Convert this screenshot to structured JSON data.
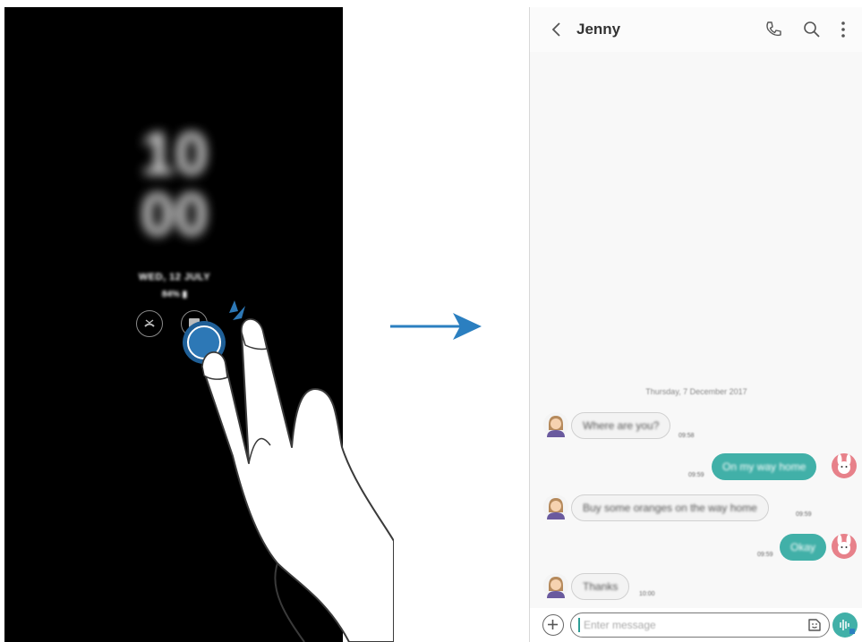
{
  "aod": {
    "clock_hour": "10",
    "clock_minute": "00",
    "date": "WED, 12 JULY",
    "battery": "84%"
  },
  "conversation": {
    "contact_name": "Jenny",
    "date_separator": "Thursday, 7 December 2017",
    "messages": [
      {
        "direction": "in",
        "text": "Where are you?",
        "time": "09:58"
      },
      {
        "direction": "out",
        "text": "On my way home",
        "time": "09:59"
      },
      {
        "direction": "in",
        "text": "Buy some oranges on the way home",
        "time": "09:59"
      },
      {
        "direction": "out",
        "text": "Okay",
        "time": "09:59"
      },
      {
        "direction": "in",
        "text": "Thanks",
        "time": "10:00"
      }
    ],
    "input_placeholder": "Enter message"
  },
  "icons": {
    "back": "chevron-left-icon",
    "call": "phone-icon",
    "search": "search-icon",
    "more": "more-vertical-icon",
    "add": "plus-icon",
    "sticker": "sticker-icon",
    "voice": "voice-icon"
  },
  "colors": {
    "accent": "#41b0a8",
    "arrow": "#2b7fc0",
    "tap": "#1f5f97"
  }
}
